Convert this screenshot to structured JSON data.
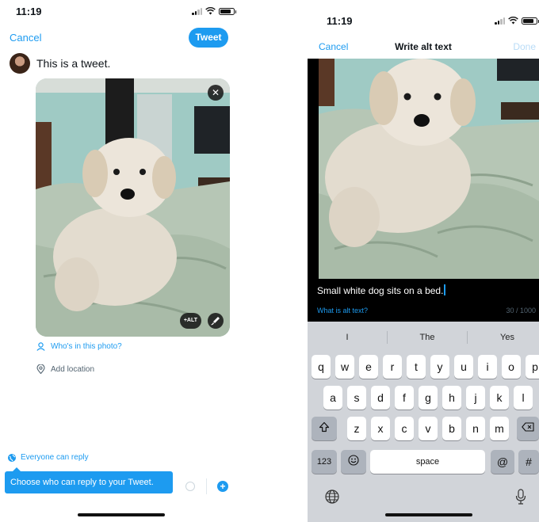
{
  "left": {
    "status": {
      "time": "11:19"
    },
    "cancel_label": "Cancel",
    "tweet_label": "Tweet",
    "tweet_text": "This is a tweet.",
    "photo": {
      "remove_icon": "close-icon",
      "alt_label": "+ALT",
      "edit_icon": "brush-icon"
    },
    "who_label": "Who's in this photo?",
    "location_label": "Add location",
    "reply_setting": "Everyone can reply",
    "reply_tooltip": "Choose who can reply to your Tweet.",
    "accent_color": "#1d9bf0"
  },
  "right": {
    "status": {
      "time": "11:19"
    },
    "cancel_label": "Cancel",
    "title": "Write alt text",
    "done_label": "Done",
    "alt_text": "Small white dog sits on a bed.",
    "help_link": "What is alt text?",
    "char_count": "30 / 1000",
    "keyboard": {
      "suggestions": [
        "I",
        "The",
        "Yes"
      ],
      "row1": [
        "q",
        "w",
        "e",
        "r",
        "t",
        "y",
        "u",
        "i",
        "o",
        "p"
      ],
      "row2": [
        "a",
        "s",
        "d",
        "f",
        "g",
        "h",
        "j",
        "k",
        "l"
      ],
      "row3": [
        "z",
        "x",
        "c",
        "v",
        "b",
        "n",
        "m"
      ],
      "numbers_key": "123",
      "space_key": "space",
      "at_key": "@",
      "hash_key": "#",
      "shift_icon": "shift-icon",
      "delete_icon": "delete-icon",
      "emoji_icon": "emoji-icon",
      "globe_icon": "globe-icon",
      "mic_icon": "microphone-icon"
    }
  }
}
